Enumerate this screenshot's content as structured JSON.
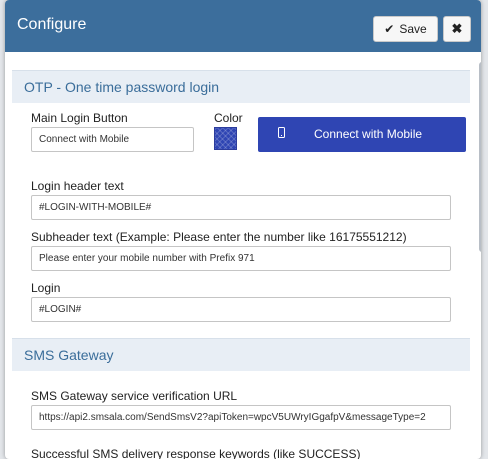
{
  "dialog": {
    "title": "Configure",
    "save_label": "Save",
    "close_label": "✖"
  },
  "otp_section": {
    "title": "OTP - One time password login",
    "main_login_button": {
      "label": "Main Login Button",
      "value": "Connect with Mobile"
    },
    "color": {
      "label": "Color",
      "value": "#2f45b3"
    },
    "preview_button": {
      "label": "Connect with Mobile",
      "icon": "mobile-phone-icon"
    },
    "login_header": {
      "label": "Login header text",
      "value": "#LOGIN-WITH-MOBILE#"
    },
    "subheader": {
      "label": "Subheader text (Example: Please enter the number like 16175551212)",
      "value": "Please enter your mobile number with Prefix 971"
    },
    "login": {
      "label": "Login",
      "value": "#LOGIN#"
    }
  },
  "sms_section": {
    "title": "SMS Gateway",
    "verification_url": {
      "label": "SMS Gateway service verification URL",
      "value": "https://api2.smsala.com/SendSmsV2?apiToken=wpcV5UWryIGgafpV&messageType=2"
    },
    "success_keywords": {
      "label": "Successful SMS delivery response keywords (like SUCCESS)"
    }
  },
  "colors": {
    "header_bg": "#3c6e9c",
    "section_bg": "#e8eef5",
    "accent": "#2f45b3"
  }
}
